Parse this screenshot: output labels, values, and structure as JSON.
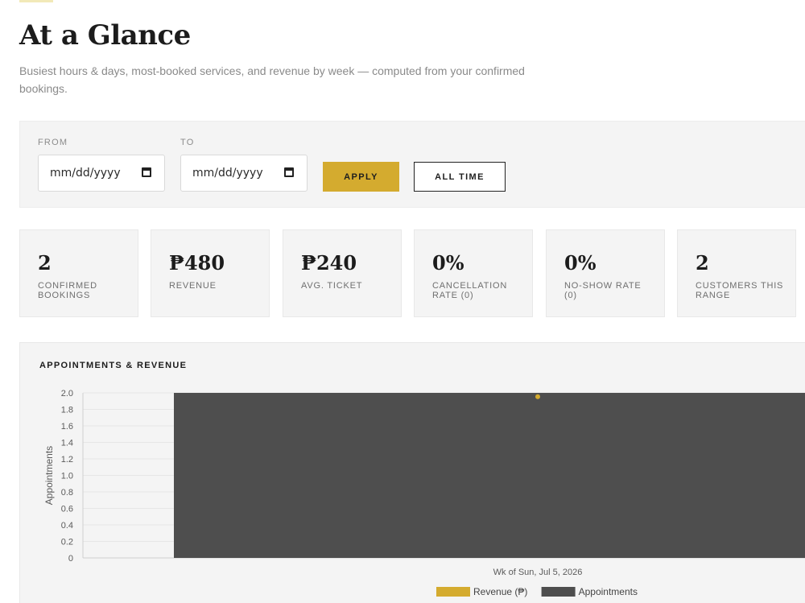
{
  "header": {
    "title": "At a Glance",
    "subtitle": "Busiest hours & days, most-booked services, and revenue by week — computed from your confirmed bookings."
  },
  "filters": {
    "from_label": "FROM",
    "to_label": "TO",
    "from_value": "mm/dd/yyyy",
    "to_value": "mm/dd/yyyy",
    "apply_label": "APPLY",
    "all_time_label": "ALL TIME"
  },
  "stats": [
    {
      "value": "2",
      "label": "CONFIRMED BOOKINGS"
    },
    {
      "value": "₱480",
      "label": "REVENUE"
    },
    {
      "value": "₱240",
      "label": "AVG. TICKET"
    },
    {
      "value": "0%",
      "label": "CANCELLATION RATE (0)"
    },
    {
      "value": "0%",
      "label": "NO-SHOW RATE (0)"
    },
    {
      "value": "2",
      "label": "CUSTOMERS THIS RANGE"
    }
  ],
  "colors": {
    "accent": "#d4ab2f",
    "bar": "#4e4e4e",
    "panel": "#f4f4f4"
  },
  "chart_data": {
    "type": "bar",
    "title": "APPOINTMENTS & REVENUE",
    "categories": [
      "Wk of Sun, Jul 5, 2026"
    ],
    "series": [
      {
        "name": "Revenue (₱)",
        "type": "line",
        "color": "#d4ab2f",
        "values": [
          480
        ]
      },
      {
        "name": "Appointments",
        "type": "bar",
        "color": "#4e4e4e",
        "values": [
          2
        ]
      }
    ],
    "ylabel": "Appointments",
    "ylim": [
      0,
      2.0
    ],
    "yticks": [
      "2.0",
      "1.8",
      "1.6",
      "1.4",
      "1.2",
      "1.0",
      "0.8",
      "0.6",
      "0.4",
      "0.2",
      "0"
    ],
    "grid": true,
    "legend": "bottom"
  }
}
